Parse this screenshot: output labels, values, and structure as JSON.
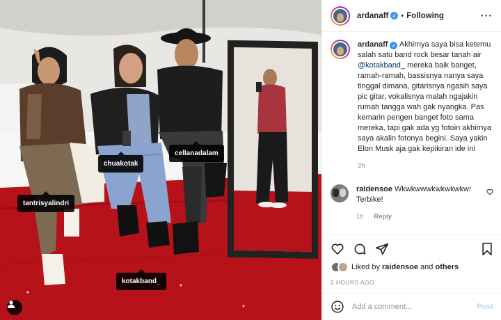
{
  "photo": {
    "tags": [
      "tantrisyalindri",
      "chuakotak",
      "cellanadalam",
      "kotakband_"
    ],
    "icons": {
      "user_tags": "person-icon"
    }
  },
  "header": {
    "username": "ardanaff",
    "separator": "•",
    "follow_label": "Following",
    "more": "···",
    "verified_icon": "verified-badge-icon"
  },
  "caption": {
    "username": "ardanaff",
    "text_before": " Akhirnya saya bisa ketemu salah satu band rock besar tanah air ",
    "mention": "@kotakband_",
    "text_after": " mereka baik banget, ramah-ramah, bassisnya nanya saya tinggal dimana, gitarisnya ngasih saya pic gitar, vokalisnya malah ngajakin rumah tangga wah gak nyangka. Pas kemarin pengen banget foto sama mereka, tapi gak ada yg fotoin akhirnya saya akalin fotonya begini. Saya yakin Elon Musk aja gak kepikiran ide ini",
    "age": "2h"
  },
  "comment": {
    "username": "raidensoe",
    "text": " Wkwkwwwkwkwkwkw! Terbike!",
    "age": "1h",
    "reply_label": "Reply"
  },
  "likes": {
    "prefix": "Liked by ",
    "user": "raidensoe",
    "middle": " and ",
    "others": "others"
  },
  "timestamp": "2 HOURS AGO",
  "add_comment": {
    "placeholder": "Add a comment...",
    "post_label": "Post"
  },
  "colors": {
    "link": "#00376b",
    "muted": "#8e8e8e",
    "post_disabled": "#b2dffc",
    "carpet": "#b7121a"
  }
}
